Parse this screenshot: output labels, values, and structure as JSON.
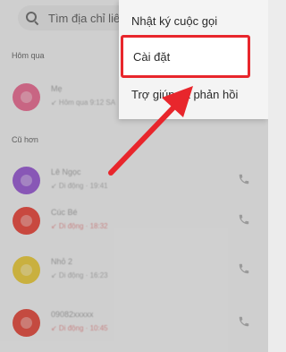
{
  "search": {
    "placeholder": "Tìm địa chỉ liên"
  },
  "sections": {
    "yesterday": "Hôm qua",
    "older": "Cũ hơn"
  },
  "calls": [
    {
      "name": "Mẹ",
      "info": "↙ Hôm qua 9:12 SA",
      "avatar_color": "#e85f88",
      "missed": false,
      "has_call_button": false
    },
    {
      "name": "Lê Ngọc",
      "info": "↙ Di động · 19:41",
      "avatar_color": "#8f4ccf",
      "missed": false,
      "has_call_button": true
    },
    {
      "name": "Cúc Bé",
      "info": "↙ Di động · 18:32",
      "avatar_color": "#e8362a",
      "missed": true,
      "has_call_button": true
    },
    {
      "name": "Nhỏ 2",
      "info": "↙ Di động · 16:23",
      "avatar_color": "#e9c62a",
      "missed": false,
      "has_call_button": true
    },
    {
      "name": "09082xxxxx",
      "info": "↙ Di động · 10:45",
      "avatar_color": "#e23a2c",
      "missed": true,
      "has_call_button": true
    }
  ],
  "menu": {
    "items": [
      {
        "label": "Nhật ký cuộc gọi"
      },
      {
        "label": "Cài đặt"
      },
      {
        "label": "Trợ giúp và phản hồi"
      }
    ]
  },
  "colors": {
    "highlight": "#e8262c",
    "arrow": "#e8262c"
  }
}
